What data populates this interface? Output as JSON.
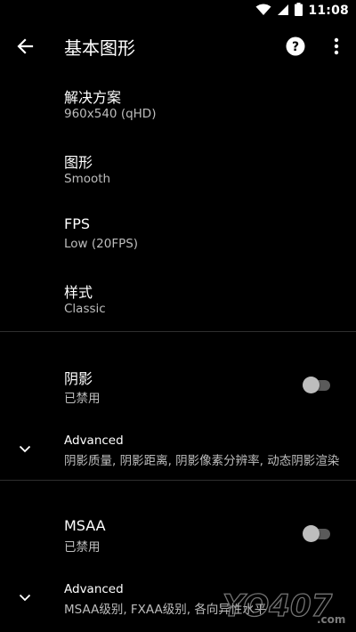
{
  "status": {
    "time": "11:08",
    "icons": [
      "wifi-icon",
      "signal-icon",
      "battery-icon"
    ]
  },
  "appbar": {
    "title": "基本图形",
    "icons": [
      "back-arrow-icon",
      "help-icon",
      "more-vert-icon"
    ]
  },
  "prefs": [
    {
      "title": "解决方案",
      "summary": "960x540 (qHD)"
    },
    {
      "title": "图形",
      "summary": "Smooth"
    },
    {
      "title": "FPS",
      "summary": "Low (20FPS)"
    },
    {
      "title": "样式",
      "summary": "Classic"
    }
  ],
  "shadow": {
    "title": "阴影",
    "summary": "已禁用",
    "enabled": false,
    "advanced": {
      "title": "Advanced",
      "summary": "阴影质量, 阴影距离, 阴影像素分辨率, 动态阴影渲染"
    }
  },
  "msaa": {
    "title": "MSAA",
    "summary": "已禁用",
    "enabled": false,
    "advanced": {
      "title": "Advanced",
      "summary": "MSAA级别, FXAA级别, 各向异性水平"
    }
  },
  "watermark": {
    "text": "YO407",
    "suffix": ".com"
  },
  "colors": {
    "background": "#000000",
    "text_primary": "#ffffff",
    "text_secondary": "#bdbdbd",
    "divider": "#2e2e2e",
    "switch_off_thumb": "#bdbdbd",
    "switch_off_track": "#5a5a5a"
  }
}
